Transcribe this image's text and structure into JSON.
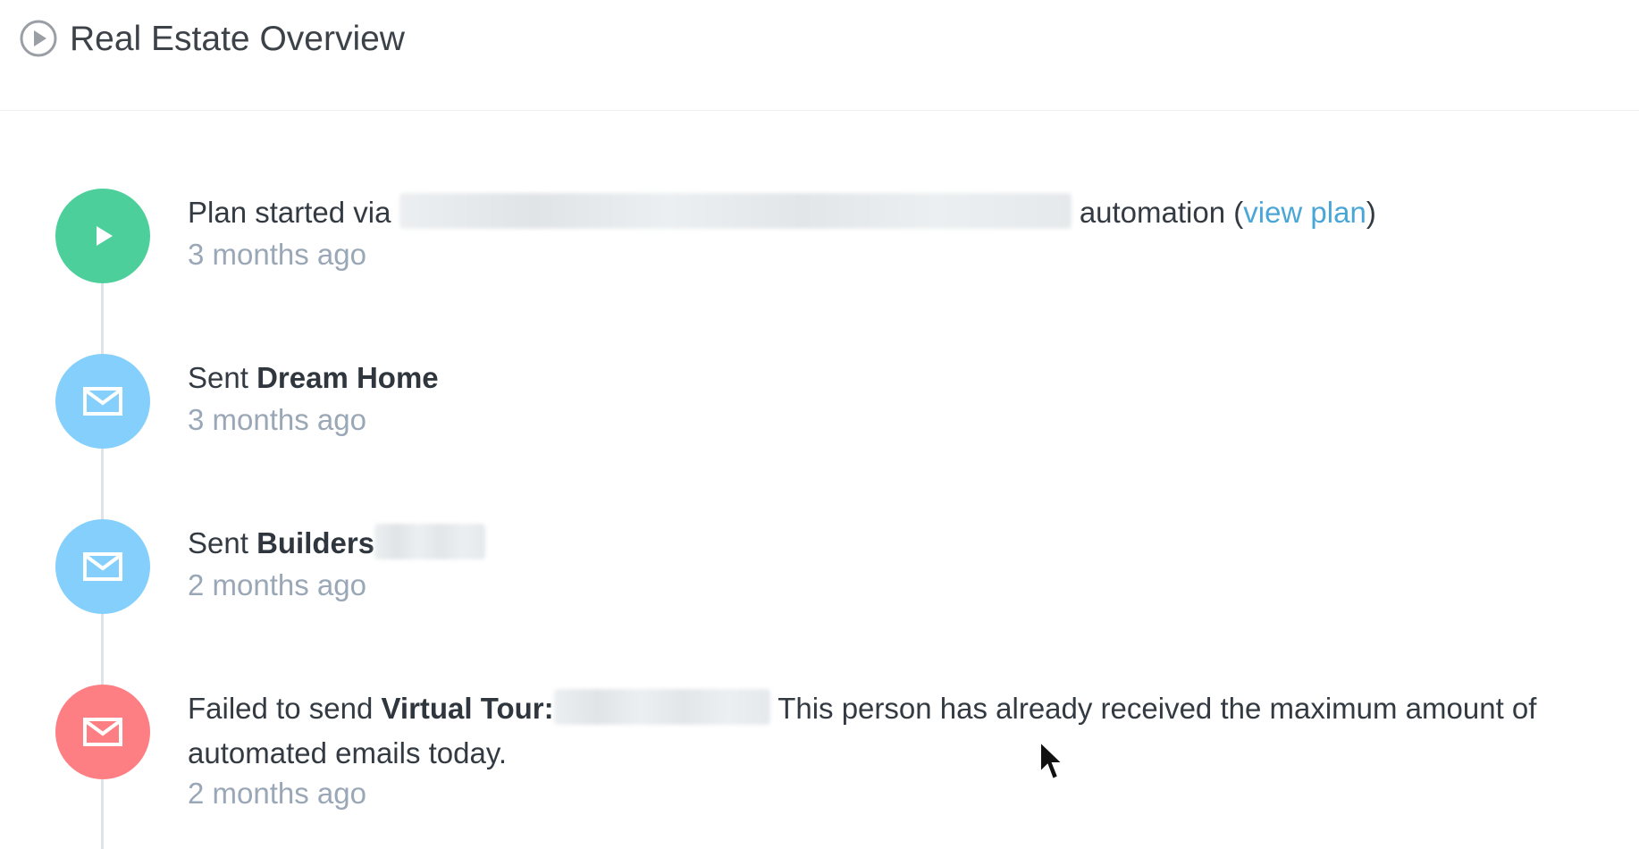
{
  "header": {
    "title": "Real Estate Overview",
    "icon": "play-circle-icon"
  },
  "colors": {
    "started": "#4ccf9a",
    "sent": "#84cffb",
    "failed": "#fe7f83",
    "link": "#4aa6d6",
    "timestamp": "#9aa7b6"
  },
  "timeline": {
    "events": [
      {
        "type": "plan-started",
        "icon": "play-icon",
        "prefix": "Plan started via",
        "suffix": "automation (",
        "link_label": "view plan",
        "link_close": ")",
        "time": "3 months ago"
      },
      {
        "type": "sent",
        "icon": "mail-icon",
        "prefix": "Sent",
        "subject": "Dream Home",
        "time": "3 months ago"
      },
      {
        "type": "sent",
        "icon": "mail-icon",
        "prefix": "Sent",
        "subject": "Builders",
        "time": "2 months ago"
      },
      {
        "type": "failed",
        "icon": "mail-icon",
        "prefix": "Failed to send",
        "subject": "Virtual Tour:",
        "message": "This person has already received the maximum amount of automated emails today.",
        "time": "2 months ago"
      }
    ]
  }
}
